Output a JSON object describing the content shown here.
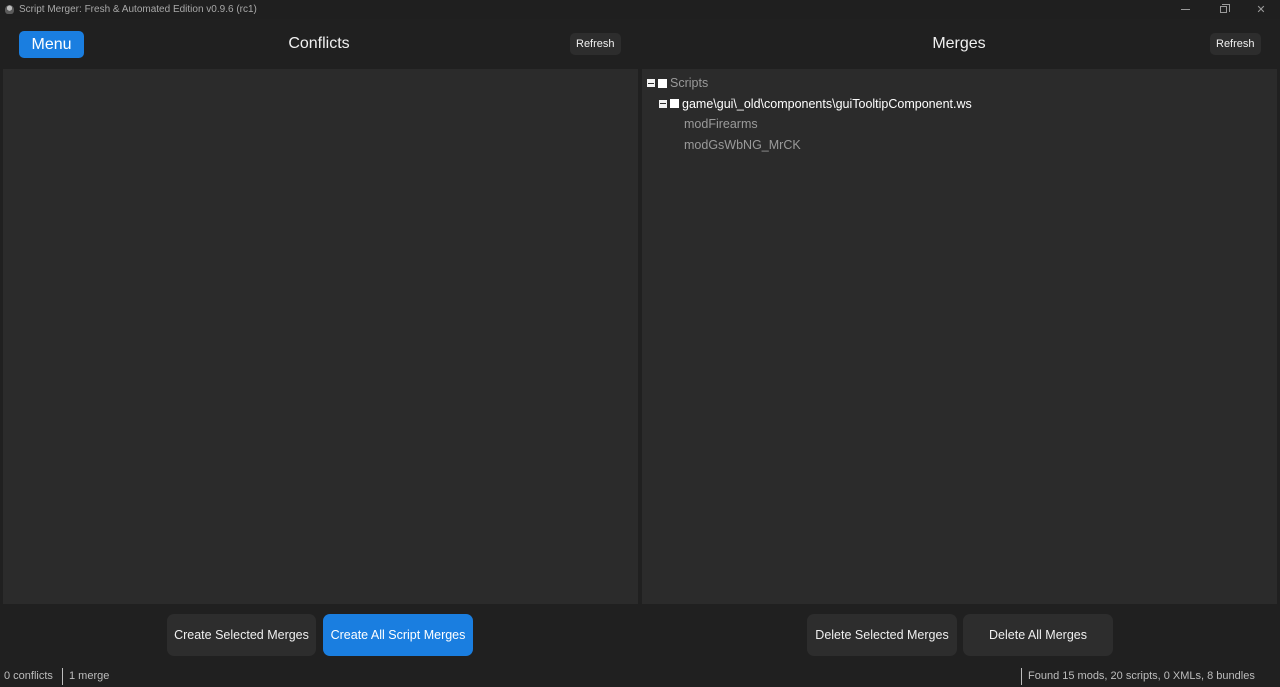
{
  "window": {
    "title": "Script Merger: Fresh & Automated Edition v0.9.6 (rc1)",
    "controls": {
      "minimize_icon": "minimize-icon",
      "restore_icon": "restore-icon",
      "close_glyph": "✕"
    }
  },
  "header": {
    "menu_label": "Menu",
    "conflicts_title": "Conflicts",
    "merges_title": "Merges",
    "refresh_label": "Refresh"
  },
  "merges_tree": {
    "root": {
      "label": "Scripts",
      "expanded": true,
      "checked": false
    },
    "file": {
      "label": "game\\gui\\_old\\components\\guiTooltipComponent.ws",
      "expanded": true,
      "checked": false
    },
    "mods": [
      "modFirearms",
      "modGsWbNG_MrCK"
    ]
  },
  "actions": {
    "create_selected": "Create Selected Merges",
    "create_all": "Create All Script Merges",
    "delete_selected": "Delete Selected Merges",
    "delete_all": "Delete All Merges"
  },
  "status": {
    "conflicts": "0 conflicts",
    "merges": "1 merge",
    "summary": "Found 15 mods, 20 scripts, 0 XMLs, 8 bundles"
  },
  "colors": {
    "accent": "#1a7ee0",
    "background": "#202020",
    "panel": "#2b2b2b",
    "button": "#2d2d2d"
  }
}
